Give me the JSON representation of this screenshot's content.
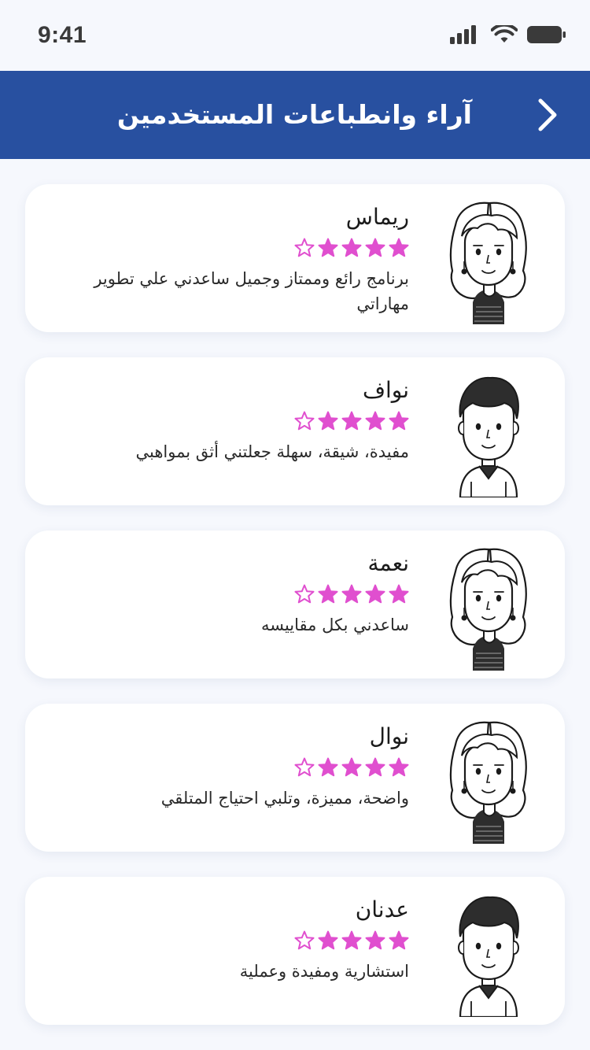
{
  "status_bar": {
    "time": "9:41",
    "icons": [
      "signal-icon",
      "wifi-icon",
      "battery-icon"
    ]
  },
  "header": {
    "title": "آراء وانطباعات المستخدمين",
    "back_icon": "chevron-right-icon",
    "background": "#2850a0"
  },
  "colors": {
    "accent": "#2850a0",
    "star": "#e04fcf"
  },
  "reviews": [
    {
      "name": "ريماس",
      "rating": 4,
      "max_rating": 5,
      "text": "برنامج رائع وممتاز وجميل ساعدني علي تطوير مهاراتي",
      "avatar": "female-avatar"
    },
    {
      "name": "نواف",
      "rating": 4,
      "max_rating": 5,
      "text": "مفيدة، شيقة، سهلة جعلتني أثق بمواهبي",
      "avatar": "male-avatar"
    },
    {
      "name": "نعمة",
      "rating": 4,
      "max_rating": 5,
      "text": "ساعدني بكل مقاييسه",
      "avatar": "female-avatar"
    },
    {
      "name": "نوال",
      "rating": 4,
      "max_rating": 5,
      "text": "واضحة، مميزة، وتلبي احتياج المتلقي",
      "avatar": "female-avatar"
    },
    {
      "name": "عدنان",
      "rating": 4,
      "max_rating": 5,
      "text": "استشارية ومفيدة وعملية",
      "avatar": "male-avatar"
    }
  ]
}
